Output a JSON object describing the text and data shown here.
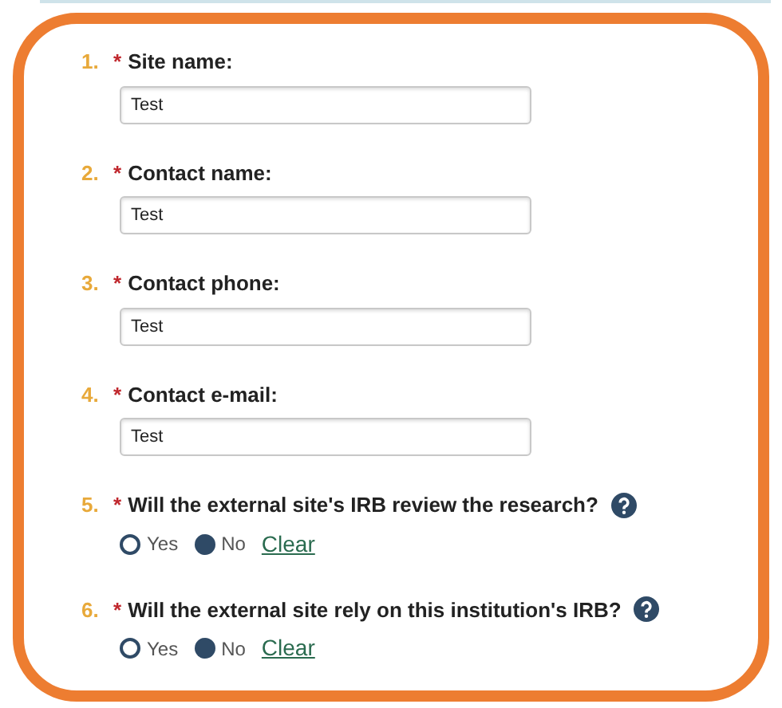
{
  "questions": [
    {
      "number": "1.",
      "marker": "*",
      "label": "Site name:",
      "kind": "text",
      "value": "Test"
    },
    {
      "number": "2.",
      "marker": "*",
      "label": "Contact name:",
      "kind": "text",
      "value": "Test"
    },
    {
      "number": "3.",
      "marker": "*",
      "label": "Contact phone:",
      "kind": "text",
      "value": "Test"
    },
    {
      "number": "4.",
      "marker": "*",
      "label": "Contact e-mail:",
      "kind": "text",
      "value": "Test"
    },
    {
      "number": "5.",
      "marker": "*",
      "label": "Will the external site's IRB review the research?",
      "kind": "radio",
      "help": true,
      "options": [
        {
          "label": "Yes",
          "selected": false
        },
        {
          "label": "No",
          "selected": true
        }
      ],
      "clear": "Clear"
    },
    {
      "number": "6.",
      "marker": "*",
      "label": "Will the external site rely on this institution's IRB?",
      "kind": "radio",
      "help": true,
      "options": [
        {
          "label": "Yes",
          "selected": false
        },
        {
          "label": "No",
          "selected": true
        }
      ],
      "clear": "Clear"
    }
  ]
}
